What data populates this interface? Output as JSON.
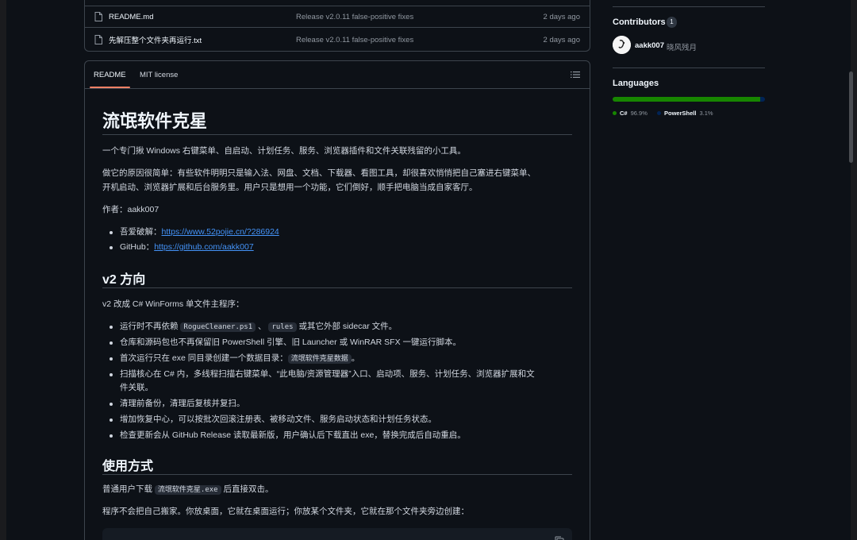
{
  "files": [
    {
      "name": "README.md",
      "message": "Release v2.0.11 false-positive fixes",
      "time": "2 days ago"
    },
    {
      "name": "先解压整个文件夹再运行.txt",
      "message": "Release v2.0.11 false-positive fixes",
      "time": "2 days ago"
    }
  ],
  "readme_tabs": {
    "readme": "README",
    "license": "MIT license"
  },
  "readme": {
    "title": "流氓软件克星",
    "p1": "一个专门揪 Windows 右键菜单、自启动、计划任务、服务、浏览器插件和文件关联残留的小工具。",
    "p2a": "做它的原因很简单：有些软件明明只是输入法、网盘、文档、下载器、看图工具，却很喜欢悄悄把自己塞进右键菜单、",
    "p2b": "开机启动、浏览器扩展和后台服务里。用户只是想用一个功能，它们倒好，顺手把电脑当成自家客厅。",
    "author": "作者：aakk007",
    "link1_label": "吾爱破解：",
    "link1_url": "https://www.52pojie.cn/?286924",
    "link2_label": "GitHub：",
    "link2_url": "https://github.com/aakk007",
    "h2_v2": "v2 方向",
    "v2_intro": "v2 改成 C# WinForms 单文件主程序：",
    "v2_items": {
      "i1a": "运行时不再依赖",
      "i1_code1": "RogueCleaner.ps1",
      "i1b": "、",
      "i1_code2": "rules",
      "i1c": "或其它外部 sidecar 文件。",
      "i2": "仓库和源码包也不再保留旧 PowerShell 引擎、旧 Launcher 或 WinRAR SFX 一键运行脚本。",
      "i3a": "首次运行只在 exe 同目录创建一个数据目录：",
      "i3_code": "流氓软件克星数据",
      "i3b": "。",
      "i4a": "扫描核心在 C# 内，多线程扫描右键菜单、“此电脑/资源管理器”入口、启动项、服务、计划任务、浏览器扩展和文",
      "i4b": "件关联。",
      "i5": "清理前备份，清理后复核并复扫。",
      "i6": "增加恢复中心，可以按批次回滚注册表、被移动文件、服务启动状态和计划任务状态。",
      "i7": "检查更新会从 GitHub Release 读取最新版，用户确认后下载直出 exe，替换完成后自动重启。"
    },
    "h2_usage": "使用方式",
    "usage_a": "普通用户下载",
    "usage_code": "流氓软件克星.exe",
    "usage_b": "后直接双击。",
    "usage_p2": "程序不会把自己搬家。你放桌面，它就在桌面运行；你放某个文件夹，它就在那个文件夹旁边创建："
  },
  "sidebar": {
    "contributors_title": "Contributors",
    "contributors_count": "1",
    "contributor_name": "aakk007",
    "contributor_alias": "晓风残月",
    "languages_title": "Languages",
    "languages": [
      {
        "name": "C#",
        "pct": "96.9%",
        "value": 96.9,
        "color": "#178600"
      },
      {
        "name": "PowerShell",
        "pct": "3.1%",
        "value": 3.1,
        "color": "#012456"
      }
    ]
  }
}
